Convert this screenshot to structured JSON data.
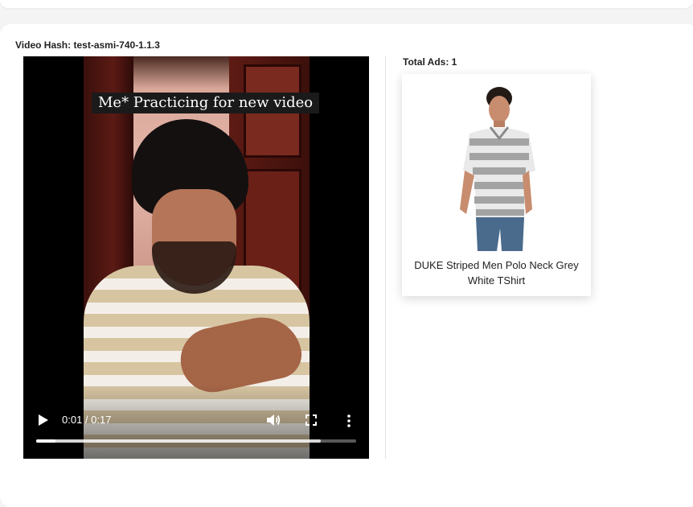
{
  "video": {
    "hash_label": "Video Hash:",
    "hash_value": "test-asmi-740-1.1.3",
    "caption": "Me* Practicing for new video",
    "current_time": "0:01",
    "time_separator": " / ",
    "duration": "0:17",
    "progress_fraction": 0.06,
    "buffered_fraction": 0.89
  },
  "ads": {
    "total_label": "Total Ads:",
    "total_count": "1",
    "items": [
      {
        "title": "DUKE Striped Men Polo Neck Grey White TShirt",
        "image_icon": "product-photo-striped-polo"
      }
    ]
  },
  "colors": {
    "page_bg": "#f4f4f4",
    "card_bg": "#ffffff",
    "controls_fg": "#ffffff"
  }
}
